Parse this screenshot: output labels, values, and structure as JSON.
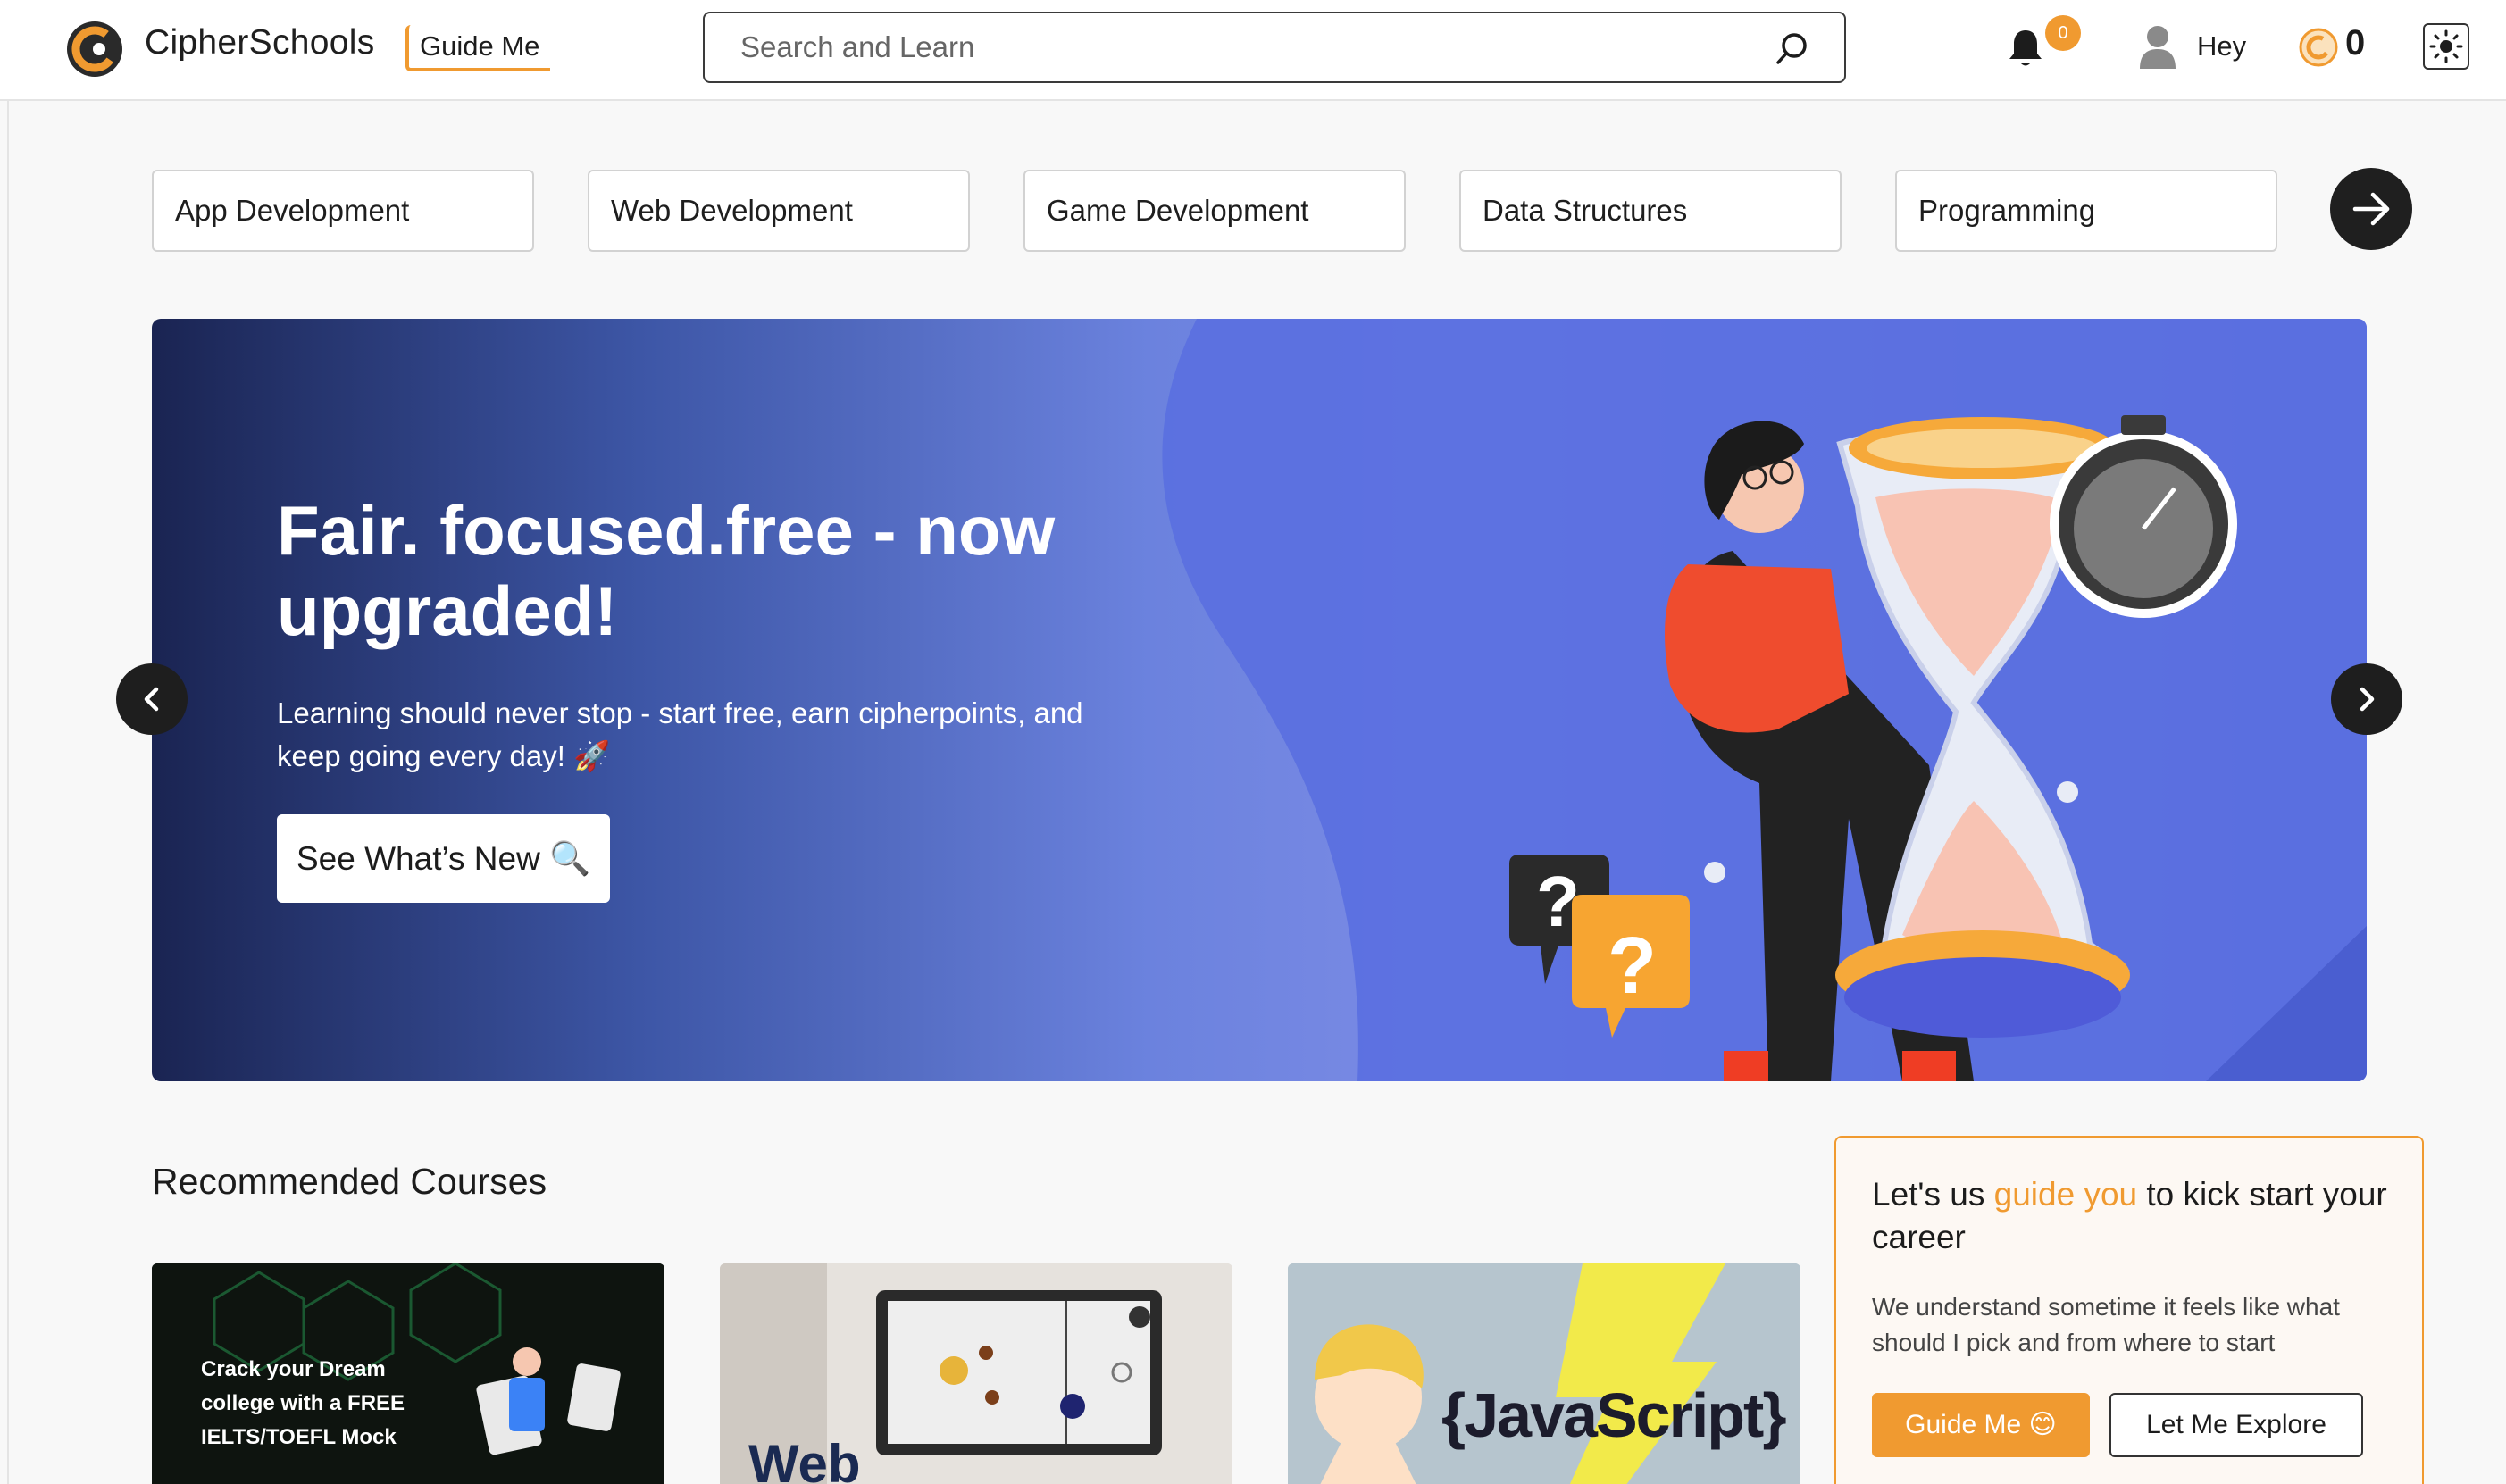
{
  "header": {
    "brand": "CipherSchools",
    "guide_label": "Guide Me",
    "search_placeholder": "Search and Learn",
    "notification_count": "0",
    "greeting": "Hey",
    "coins": "0"
  },
  "categories": [
    "App Development",
    "Web Development",
    "Game Development",
    "Data Structures",
    "Programming"
  ],
  "hero": {
    "title": "Fair. focused.free - now upgraded!",
    "subtitle": "Learning should never stop - start free, earn cipherpoints, and keep going every day! 🚀",
    "cta": "See What’s New 🔍"
  },
  "recommended": {
    "title": "Recommended Courses",
    "courses": [
      {
        "thumb_text": "Crack your Dream college with a FREE IELTS/TOEFL Mock"
      },
      {
        "thumb_text": "Web"
      },
      {
        "thumb_text": "{JavaScript}"
      }
    ]
  },
  "guide_panel": {
    "title_pre": "Let's us ",
    "title_hl": "guide you",
    "title_post": " to kick start your career",
    "desc": "We understand sometime it feels like what should I pick and from where to start",
    "btn_primary": "Guide Me 😊",
    "btn_secondary": "Let Me Explore"
  },
  "colors": {
    "accent": "#f09a30",
    "hero_dark": "#1a2452",
    "hero_light": "#7d8ce6"
  }
}
